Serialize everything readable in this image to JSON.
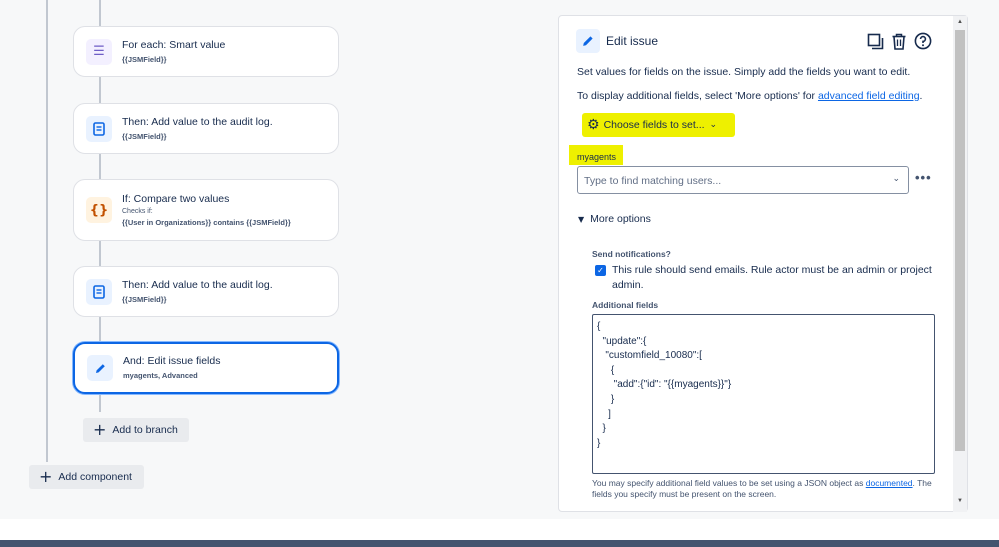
{
  "flow": {
    "cards": [
      {
        "title": "For each: Smart value",
        "sub": "{{JSMField}}",
        "icon": "list-icon"
      },
      {
        "title": "Then: Add value to the audit log.",
        "sub": "{{JSMField}}",
        "icon": "document-icon"
      },
      {
        "title": "If: Compare two values",
        "small": "Checks if:",
        "sub": "{{User in Organizations}} contains {{JSMField}}",
        "icon": "braces-icon"
      },
      {
        "title": "Then: Add value to the audit log.",
        "sub": "{{JSMField}}",
        "icon": "document-icon"
      },
      {
        "title": "And: Edit issue fields",
        "sub": "myagents, Advanced",
        "icon": "pencil-icon"
      }
    ],
    "add_to_branch": "Add to branch",
    "add_component": "Add component"
  },
  "panel": {
    "title": "Edit issue",
    "desc1": "Set values for fields on the issue. Simply add the fields you want to edit.",
    "desc2_prefix": "To display additional fields, select 'More options' for ",
    "desc2_link": "advanced field editing",
    "desc2_suffix": ".",
    "choose_fields": "Choose fields to set...",
    "field_label": "myagents",
    "user_placeholder": "Type to find matching users...",
    "more_options": "More options",
    "send_notifications_label": "Send notifications?",
    "send_notifications_checked": true,
    "send_notifications_text": "This rule should send emails. Rule actor must be an admin or project admin.",
    "additional_fields_label": "Additional fields",
    "additional_fields_value": "{\n  \"update\":{\n   \"customfield_10080\":[\n     {\n      \"add\":{\"id\": \"{{myagents}}\"}\n     }\n    ]\n  }\n}",
    "footer_prefix": "You may specify additional field values to be set using a JSON object as ",
    "footer_link": "documented",
    "footer_line2": ". The fields you specify must be present on the screen."
  },
  "colors": {
    "accent": "#0c66e4",
    "highlight": "#eef000"
  }
}
